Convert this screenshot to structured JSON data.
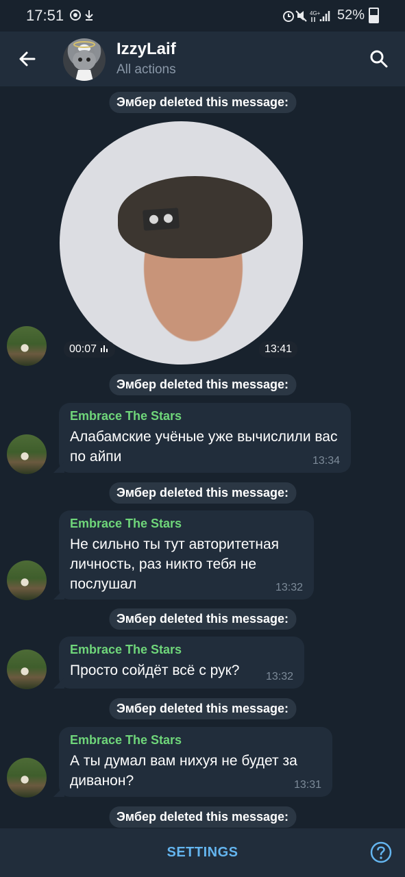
{
  "status_bar": {
    "time": "17:51",
    "battery": "52%",
    "network": "4G+"
  },
  "header": {
    "title": "IzzyLaif",
    "subtitle": "All actions"
  },
  "events": [
    {
      "type": "service",
      "text": "Эмбер deleted this message:"
    },
    {
      "type": "video",
      "duration": "00:07",
      "time": "13:41"
    },
    {
      "type": "service",
      "text": "Эмбер deleted this message:"
    },
    {
      "type": "message",
      "author": "Embrace The Stars",
      "text": "Алабамские учёные уже вычислили вас по айпи",
      "time": "13:34"
    },
    {
      "type": "service",
      "text": "Эмбер deleted this message:"
    },
    {
      "type": "message",
      "author": "Embrace The Stars",
      "text": "Не сильно ты тут авторитетная личность, раз никто тебя не послушал",
      "time": "13:32"
    },
    {
      "type": "service",
      "text": "Эмбер deleted this message:"
    },
    {
      "type": "message",
      "author": "Embrace The Stars",
      "text": "Просто сойдёт всё с рук?",
      "time": "13:32"
    },
    {
      "type": "service",
      "text": "Эмбер deleted this message:"
    },
    {
      "type": "message",
      "author": "Embrace The Stars",
      "text": "А ты думал вам нихуя не будет за диванон?",
      "time": "13:31"
    },
    {
      "type": "service",
      "text": "Эмбер deleted this message:"
    }
  ],
  "bottom_bar": {
    "settings_label": "SETTINGS"
  },
  "colors": {
    "background": "#18222d",
    "bar": "#212d3b",
    "bubble": "#212d3b",
    "author_name": "#6fd67a",
    "accent": "#64b5ef"
  }
}
